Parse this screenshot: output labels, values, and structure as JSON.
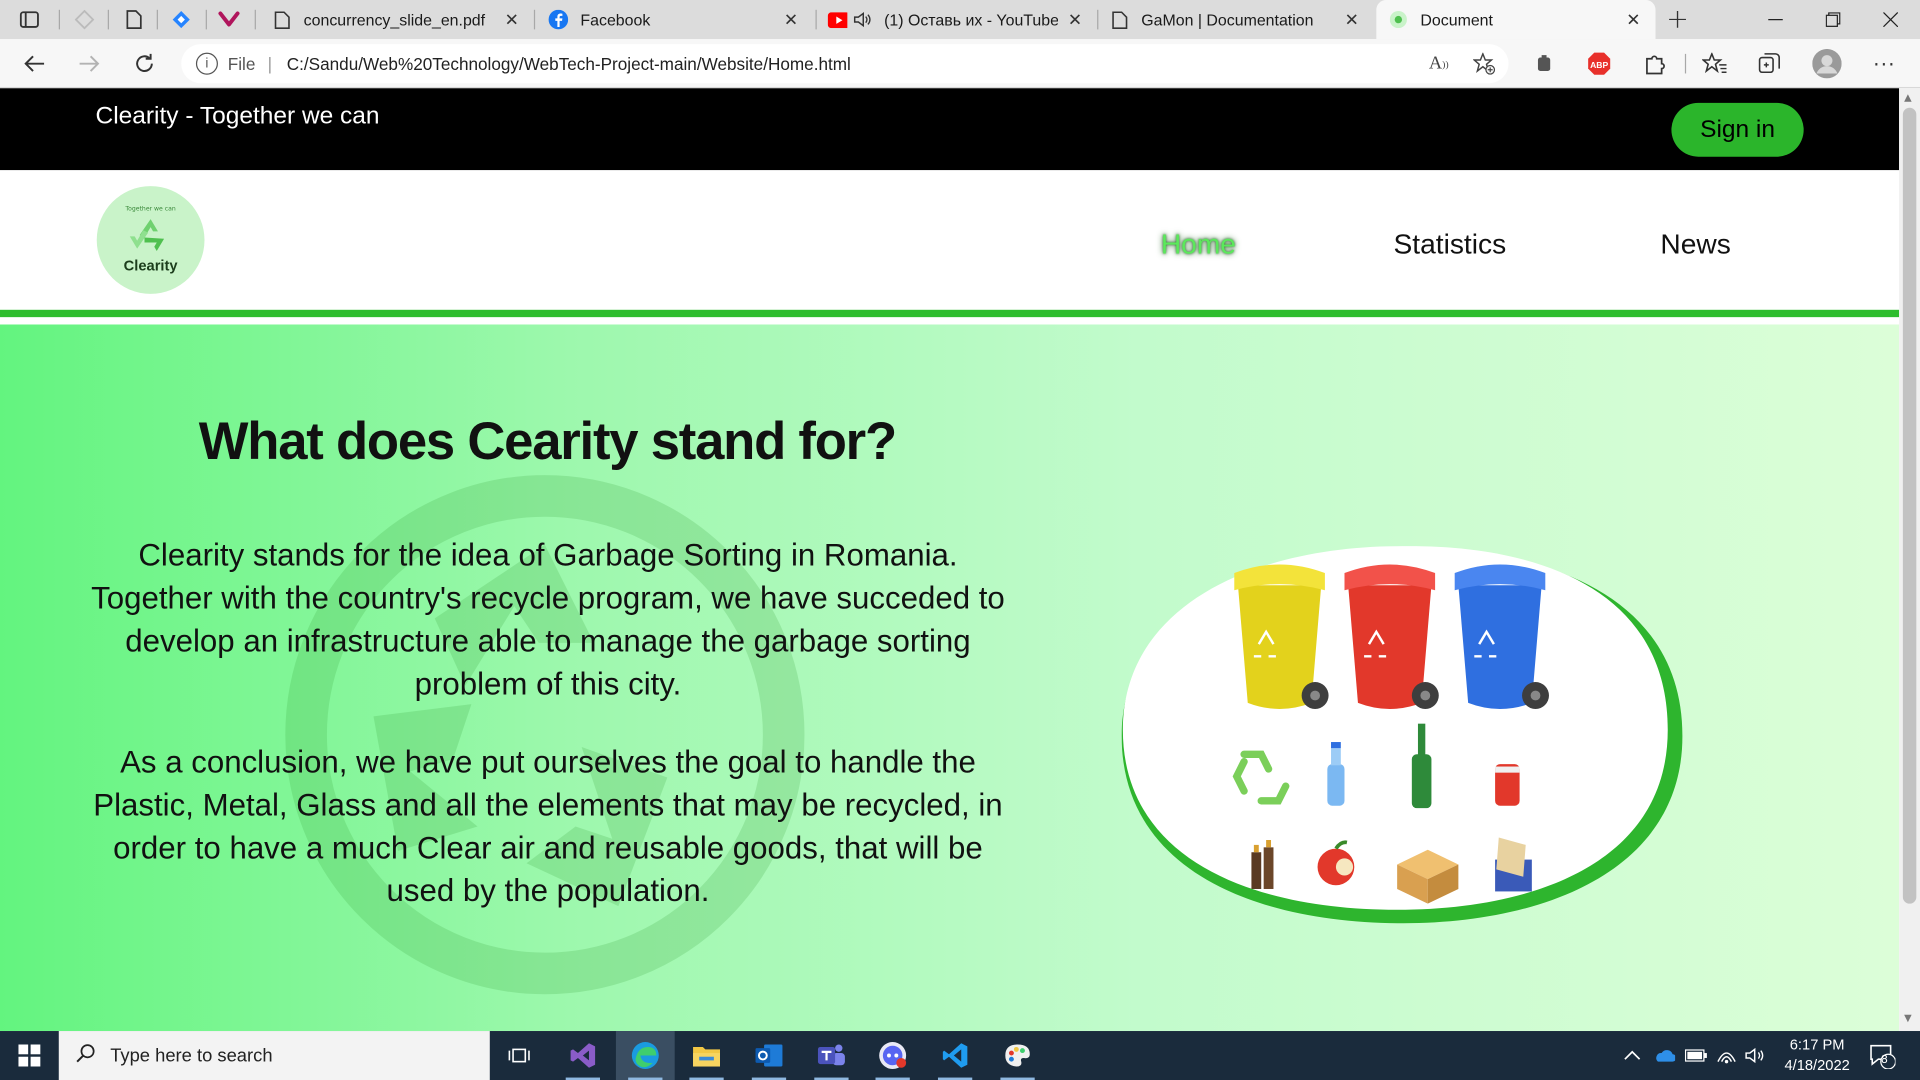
{
  "browser": {
    "tabs": [
      {
        "title": "concurrency_slide_en.pdf",
        "icon": "file-icon"
      },
      {
        "title": "Facebook",
        "icon": "facebook-icon"
      },
      {
        "title": "(1) Оставь их - YouTube",
        "icon": "youtube-icon"
      },
      {
        "title": "GaMon | Documentation",
        "icon": "file-icon"
      },
      {
        "title": "Document",
        "icon": "document-favicon",
        "active": true
      }
    ],
    "address": {
      "scheme": "File",
      "url": "C:/Sandu/Web%20Technology/WebTech-Project-main/Website/Home.html"
    }
  },
  "site": {
    "tagline": "Clearity - Together we can",
    "signin_label": "Sign in",
    "logo": {
      "small_text": "Together we can",
      "name": "Clearity"
    },
    "nav": [
      {
        "label": "Home",
        "active": true
      },
      {
        "label": "Statistics"
      },
      {
        "label": "News"
      }
    ],
    "hero": {
      "title": "What does Cearity stand for?",
      "paragraphs": [
        "Clearity stands for the idea of Garbage Sorting in Romania. Together with the country's recycle program, we have succeded to develop an infrastructure able to manage the garbage sorting problem of this city.",
        "As a conclusion, we have put ourselves the goal to handle the Plastic, Metal, Glass and all the elements that may be recycled, in order to have a much Clear air and reusable goods, that will be used by the population."
      ],
      "image": "recycling-bins-illustration",
      "colors": {
        "accent": "#2ebd2e",
        "gradient_start": "#63f47f",
        "gradient_end": "#dcfed8"
      }
    }
  },
  "taskbar": {
    "search_placeholder": "Type here to search",
    "time": "6:17 PM",
    "date": "4/18/2022",
    "notifications": "8",
    "apps": [
      "task-view",
      "visual-studio",
      "edge",
      "file-explorer",
      "outlook",
      "teams",
      "discord",
      "vscode",
      "paint"
    ]
  }
}
